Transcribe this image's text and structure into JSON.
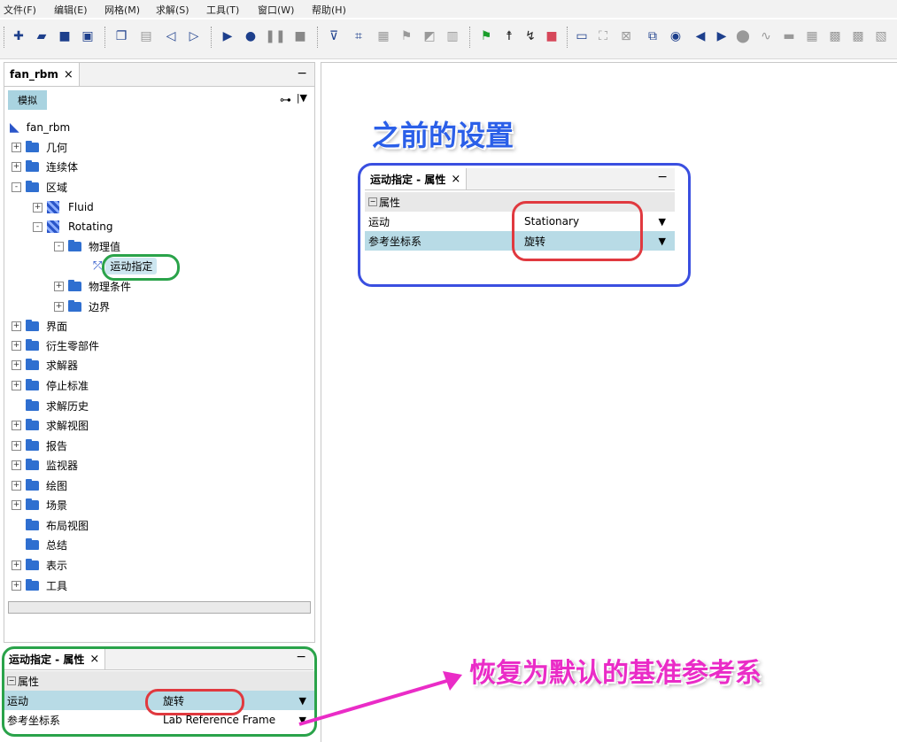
{
  "menu": [
    "文件(F)",
    "编辑(E)",
    "网格(M)",
    "求解(S)",
    "工具(T)",
    "窗口(W)",
    "帮助(H)"
  ],
  "toolbar_icons": [
    "new-icon",
    "open-icon",
    "save-icon",
    "save-as-icon",
    "copy-icon",
    "document-icon",
    "back-icon",
    "forward-icon",
    "run-icon",
    "record-icon",
    "pause-icon",
    "stop-icon",
    "filter-icon",
    "mesh-icon",
    "scene-icon",
    "flag-icon",
    "geometry-icon",
    "grid-icon",
    "green-flag-icon",
    "walk-icon",
    "run-fast-icon",
    "red-stop-icon",
    "monitor-icon",
    "expand-icon",
    "grid-view-icon",
    "window-icon",
    "camera-icon",
    "arrow-left-icon",
    "arrow-right-icon",
    "sphere-icon",
    "plot-icon",
    "layout-icon",
    "table-icon",
    "panel-icon"
  ],
  "left_panel": {
    "tab_title": "fan_rbm",
    "close": "×",
    "minimize": "−",
    "sim_tab": "模拟",
    "tree": [
      {
        "label": "fan_rbm",
        "level": 0,
        "icon": "sim",
        "exp": ""
      },
      {
        "label": "几何",
        "level": 0,
        "icon": "folder",
        "exp": "+"
      },
      {
        "label": "连续体",
        "level": 0,
        "icon": "folder",
        "exp": "+"
      },
      {
        "label": "区域",
        "level": 0,
        "icon": "folder",
        "exp": "-"
      },
      {
        "label": "Fluid",
        "level": 1,
        "icon": "region",
        "exp": "+"
      },
      {
        "label": "Rotating",
        "level": 1,
        "icon": "region",
        "exp": "-"
      },
      {
        "label": "物理值",
        "level": 2,
        "icon": "folder",
        "exp": "-"
      },
      {
        "label": "运动指定",
        "level": 3,
        "icon": "motion",
        "exp": ""
      },
      {
        "label": "物理条件",
        "level": 2,
        "icon": "folder",
        "exp": "+"
      },
      {
        "label": "边界",
        "level": 2,
        "icon": "folder",
        "exp": "+"
      },
      {
        "label": "界面",
        "level": 0,
        "icon": "folder",
        "exp": "+"
      },
      {
        "label": "衍生零部件",
        "level": 0,
        "icon": "folder",
        "exp": "+"
      },
      {
        "label": "求解器",
        "level": 0,
        "icon": "folder",
        "exp": "+"
      },
      {
        "label": "停止标准",
        "level": 0,
        "icon": "folder",
        "exp": "+"
      },
      {
        "label": "求解历史",
        "level": 0,
        "icon": "folder",
        "exp": ""
      },
      {
        "label": "求解视图",
        "level": 0,
        "icon": "folder",
        "exp": "+"
      },
      {
        "label": "报告",
        "level": 0,
        "icon": "folder",
        "exp": "+"
      },
      {
        "label": "监视器",
        "level": 0,
        "icon": "folder",
        "exp": "+"
      },
      {
        "label": "绘图",
        "level": 0,
        "icon": "folder",
        "exp": "+"
      },
      {
        "label": "场景",
        "level": 0,
        "icon": "folder",
        "exp": "+"
      },
      {
        "label": "布局视图",
        "level": 0,
        "icon": "folder",
        "exp": ""
      },
      {
        "label": "总结",
        "level": 0,
        "icon": "folder",
        "exp": ""
      },
      {
        "label": "表示",
        "level": 0,
        "icon": "folder",
        "exp": "+"
      },
      {
        "label": "工具",
        "level": 0,
        "icon": "folder",
        "exp": "+"
      }
    ]
  },
  "bottom_panel": {
    "tab_title": "运动指定 - 属性",
    "close": "×",
    "minimize": "−",
    "section": "属性",
    "rows": [
      {
        "key": "运动",
        "value": "旋转"
      },
      {
        "key": "参考坐标系",
        "value": "Lab Reference Frame"
      }
    ]
  },
  "inset_panel": {
    "tab_title": "运动指定 - 属性",
    "close": "×",
    "minimize": "−",
    "section": "属性",
    "rows": [
      {
        "key": "运动",
        "value": "Stationary"
      },
      {
        "key": "参考坐标系",
        "value": "旋转"
      }
    ]
  },
  "annotations": {
    "before_heading": "之前的设置",
    "restore_heading": "恢复为默认的基准参考系"
  },
  "colors": {
    "annotation_blue": "#2b5fe8",
    "annotation_pink": "#ea2cc7",
    "oval_green": "#2aa34a",
    "oval_red": "#e0393f",
    "selected_row": "#b8dbe6",
    "folder_blue": "#2f6fd0"
  }
}
